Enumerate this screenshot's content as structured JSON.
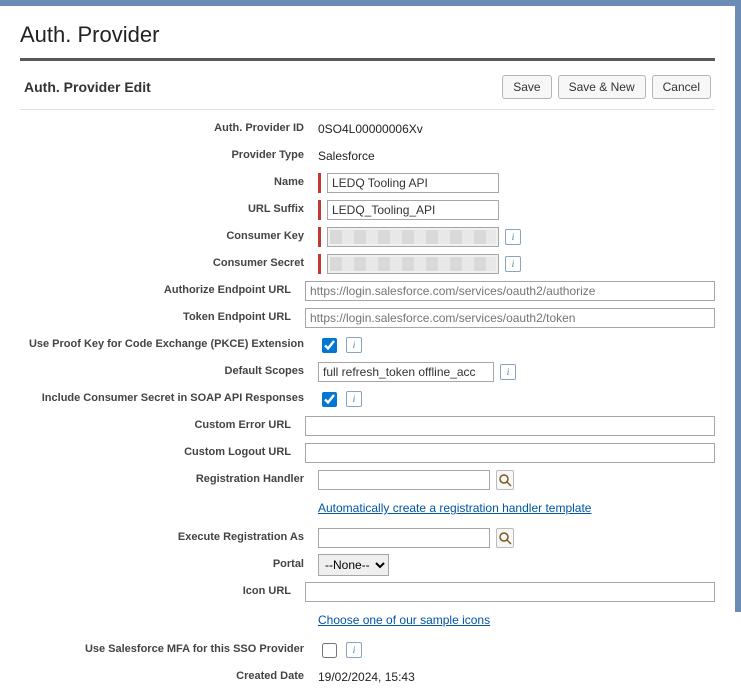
{
  "page": {
    "title": "Auth. Provider"
  },
  "section": {
    "title": "Auth. Provider Edit",
    "buttons": {
      "save": "Save",
      "saveNew": "Save & New",
      "cancel": "Cancel"
    }
  },
  "fields": {
    "authProviderId": {
      "label": "Auth. Provider ID",
      "value": "0SO4L00000006Xv"
    },
    "providerType": {
      "label": "Provider Type",
      "value": "Salesforce"
    },
    "name": {
      "label": "Name",
      "value": "LEDQ Tooling API"
    },
    "urlSuffix": {
      "label": "URL Suffix",
      "value": "LEDQ_Tooling_API"
    },
    "consumerKey": {
      "label": "Consumer Key"
    },
    "consumerSecret": {
      "label": "Consumer Secret"
    },
    "authorizeUrl": {
      "label": "Authorize Endpoint URL",
      "placeholder": "https://login.salesforce.com/services/oauth2/authorize"
    },
    "tokenUrl": {
      "label": "Token Endpoint URL",
      "placeholder": "https://login.salesforce.com/services/oauth2/token"
    },
    "pkce": {
      "label": "Use Proof Key for Code Exchange (PKCE) Extension",
      "checked": true
    },
    "defaultScopes": {
      "label": "Default Scopes",
      "value": "full refresh_token offline_acc"
    },
    "includeSecret": {
      "label": "Include Consumer Secret in SOAP API Responses",
      "checked": true
    },
    "customErrorUrl": {
      "label": "Custom Error URL",
      "value": ""
    },
    "customLogoutUrl": {
      "label": "Custom Logout URL",
      "value": ""
    },
    "regHandler": {
      "label": "Registration Handler",
      "value": "",
      "link": "Automatically create a registration handler template"
    },
    "execRegAs": {
      "label": "Execute Registration As",
      "value": ""
    },
    "portal": {
      "label": "Portal",
      "selected": "--None--"
    },
    "iconUrl": {
      "label": "Icon URL",
      "value": "",
      "link": "Choose one of our sample icons"
    },
    "useMfa": {
      "label": "Use Salesforce MFA for this SSO Provider",
      "checked": false
    },
    "createdDate": {
      "label": "Created Date",
      "value": "19/02/2024, 15:43"
    }
  }
}
